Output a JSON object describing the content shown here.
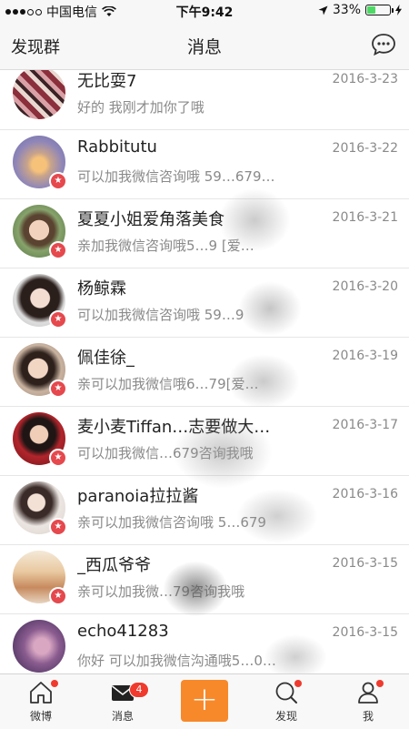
{
  "status_bar": {
    "carrier": "中国电信",
    "time": "下午9:42",
    "battery_percent": "33%"
  },
  "nav": {
    "left": "发现群",
    "title": "消息",
    "right_icon": "chat-bubble-icon"
  },
  "conversations": [
    {
      "name": "无比耍7",
      "date": "2016-3-23",
      "snippet": "好的 我刚才加你了哦",
      "verified": false
    },
    {
      "name": "Rabbitutu",
      "date": "2016-3-22",
      "snippet": "可以加我微信咨询哦 59…679…",
      "verified": true
    },
    {
      "name": "夏夏小姐爱角落美食",
      "date": "2016-3-21",
      "snippet": "亲加我微信咨询哦5…9 [爱…",
      "verified": true
    },
    {
      "name": "杨鲸霖",
      "date": "2016-3-20",
      "snippet": "可以加我微信咨询哦 59…9",
      "verified": true
    },
    {
      "name": "佩佳徐_",
      "date": "2016-3-19",
      "snippet": "亲可以加我微信哦6…79[爱…",
      "verified": true
    },
    {
      "name": "麦小麦Tiffan…志要做大…",
      "date": "2016-3-17",
      "snippet": "可以加我微信…679咨询我哦",
      "verified": true
    },
    {
      "name": "paranoia拉拉酱",
      "date": "2016-3-16",
      "snippet": "亲可以加我微信咨询哦 5…679",
      "verified": true
    },
    {
      "name": "_西瓜爷爷",
      "date": "2016-3-15",
      "snippet": "亲可以加我微…79咨询我哦",
      "verified": true
    },
    {
      "name": "echo41283",
      "date": "2016-3-15",
      "snippet": "你好 可以加我微信沟通哦5…0…",
      "verified": false
    }
  ],
  "tabs": [
    {
      "label": "微博",
      "icon": "home-icon",
      "dot": true
    },
    {
      "label": "消息",
      "icon": "envelope-icon",
      "badge": "4"
    },
    {
      "label": "",
      "icon": "plus-icon"
    },
    {
      "label": "发现",
      "icon": "discover-search-icon",
      "dot": true
    },
    {
      "label": "我",
      "icon": "profile-icon",
      "dot": true
    }
  ],
  "colors": {
    "accent_orange": "#f7892b",
    "badge_red": "#f03a2e",
    "battery_green": "#4cd964"
  }
}
